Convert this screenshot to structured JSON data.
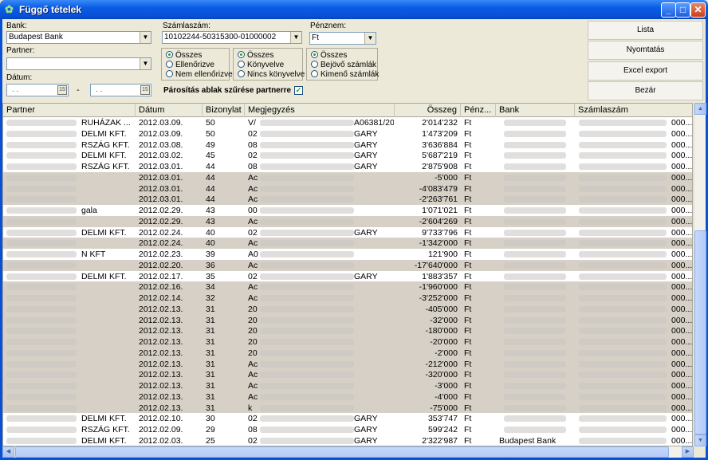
{
  "window": {
    "title": "Függő tételek"
  },
  "filters": {
    "bank_label": "Bank:",
    "bank_value": "Budapest Bank",
    "account_label": "Számlaszám:",
    "account_value": "10102244-50315300-01000002",
    "currency_label": "Pénznem:",
    "currency_value": "Ft",
    "partner_label": "Partner:",
    "partner_value": "",
    "date_label": "Dátum:",
    "date_from": ". .",
    "date_sep": "-",
    "date_to": ". .",
    "group1": [
      "Összes",
      "Ellenőrizve",
      "Nem ellenőrizve"
    ],
    "group2": [
      "Összes",
      "Könyvelve",
      "Nincs könyvelve"
    ],
    "group3": [
      "Összes",
      "Bejövő számlák",
      "Kimenő számlák"
    ],
    "checkbox_label": "Párosítás ablak szűrése partnerre",
    "checkbox_checked": true
  },
  "buttons": {
    "list": "Lista",
    "print": "Nyomtatás",
    "excel": "Excel export",
    "close": "Bezár"
  },
  "columns": [
    "Partner",
    "Dátum",
    "Bizonylat",
    "Megjegyzés",
    "Összeg",
    "Pénz...",
    "Bank",
    "Számlaszám"
  ],
  "rows": [
    {
      "partner": "RUHÁZAK ...",
      "date": "2012.03.09.",
      "doc": "50",
      "note_start": "V/",
      "note_end": "A06381/20",
      "amount": "2'014'232",
      "cur": "Ft",
      "bank": "",
      "acct_end": "000..."
    },
    {
      "partner": "DELMI KFT.",
      "date": "2012.03.09.",
      "doc": "50",
      "note_start": "02",
      "note_end": "GARY",
      "amount": "1'473'209",
      "cur": "Ft",
      "bank": "",
      "acct_end": "000..."
    },
    {
      "partner": "RSZÁG KFT.",
      "date": "2012.03.08.",
      "doc": "49",
      "note_start": "08",
      "note_end": "GARY",
      "amount": "3'636'884",
      "cur": "Ft",
      "bank": "",
      "acct_end": "000..."
    },
    {
      "partner": "DELMI KFT.",
      "date": "2012.03.02.",
      "doc": "45",
      "note_start": "02",
      "note_end": "GARY",
      "amount": "5'687'219",
      "cur": "Ft",
      "bank": "",
      "acct_end": "000..."
    },
    {
      "partner": "RSZÁG KFT.",
      "date": "2012.03.01.",
      "doc": "44",
      "note_start": "08",
      "note_end": "GARY",
      "amount": "2'875'908",
      "cur": "Ft",
      "bank": "",
      "acct_end": "000..."
    },
    {
      "partner": "",
      "date": "2012.03.01.",
      "doc": "44",
      "note_start": "Ac",
      "note_end": "",
      "amount": "-5'000",
      "cur": "Ft",
      "bank": "",
      "acct_end": "000..."
    },
    {
      "partner": "",
      "date": "2012.03.01.",
      "doc": "44",
      "note_start": "Ac",
      "note_end": "",
      "amount": "-4'083'479",
      "cur": "Ft",
      "bank": "",
      "acct_end": "000..."
    },
    {
      "partner": "",
      "date": "2012.03.01.",
      "doc": "44",
      "note_start": "Ac",
      "note_end": "",
      "amount": "-2'263'761",
      "cur": "Ft",
      "bank": "",
      "acct_end": "000..."
    },
    {
      "partner": "gala",
      "date": "2012.02.29.",
      "doc": "43",
      "note_start": "00",
      "note_end": "",
      "amount": "1'071'021",
      "cur": "Ft",
      "bank": "",
      "acct_end": "000..."
    },
    {
      "partner": "",
      "date": "2012.02.29.",
      "doc": "43",
      "note_start": "Ac",
      "note_end": "",
      "amount": "-2'604'269",
      "cur": "Ft",
      "bank": "",
      "acct_end": "000..."
    },
    {
      "partner": "DELMI KFT.",
      "date": "2012.02.24.",
      "doc": "40",
      "note_start": "02",
      "note_end": "GARY",
      "amount": "9'733'796",
      "cur": "Ft",
      "bank": "",
      "acct_end": "000..."
    },
    {
      "partner": "",
      "date": "2012.02.24.",
      "doc": "40",
      "note_start": "Ac",
      "note_end": "",
      "amount": "-1'342'000",
      "cur": "Ft",
      "bank": "",
      "acct_end": "000..."
    },
    {
      "partner": "N KFT",
      "date": "2012.02.23.",
      "doc": "39",
      "note_start": "A0",
      "note_end": "",
      "amount": "121'900",
      "cur": "Ft",
      "bank": "",
      "acct_end": "000..."
    },
    {
      "partner": "",
      "date": "2012.02.20.",
      "doc": "36",
      "note_start": "Ac",
      "note_end": "",
      "amount": "-17'640'000",
      "cur": "Ft",
      "bank": "",
      "acct_end": "000..."
    },
    {
      "partner": "DELMI KFT.",
      "date": "2012.02.17.",
      "doc": "35",
      "note_start": "02",
      "note_end": "GARY",
      "amount": "1'883'357",
      "cur": "Ft",
      "bank": "",
      "acct_end": "000..."
    },
    {
      "partner": "",
      "date": "2012.02.16.",
      "doc": "34",
      "note_start": "Ac",
      "note_end": "",
      "amount": "-1'960'000",
      "cur": "Ft",
      "bank": "",
      "acct_end": "000..."
    },
    {
      "partner": "",
      "date": "2012.02.14.",
      "doc": "32",
      "note_start": "Ac",
      "note_end": "",
      "amount": "-3'252'000",
      "cur": "Ft",
      "bank": "",
      "acct_end": "000..."
    },
    {
      "partner": "",
      "date": "2012.02.13.",
      "doc": "31",
      "note_start": "20",
      "note_end": "",
      "amount": "-405'000",
      "cur": "Ft",
      "bank": "",
      "acct_end": "000..."
    },
    {
      "partner": "",
      "date": "2012.02.13.",
      "doc": "31",
      "note_start": "20",
      "note_end": "",
      "amount": "-32'000",
      "cur": "Ft",
      "bank": "",
      "acct_end": "000..."
    },
    {
      "partner": "",
      "date": "2012.02.13.",
      "doc": "31",
      "note_start": "20",
      "note_end": "",
      "amount": "-180'000",
      "cur": "Ft",
      "bank": "",
      "acct_end": "000..."
    },
    {
      "partner": "",
      "date": "2012.02.13.",
      "doc": "31",
      "note_start": "20",
      "note_end": "",
      "amount": "-20'000",
      "cur": "Ft",
      "bank": "",
      "acct_end": "000..."
    },
    {
      "partner": "",
      "date": "2012.02.13.",
      "doc": "31",
      "note_start": "20",
      "note_end": "",
      "amount": "-2'000",
      "cur": "Ft",
      "bank": "",
      "acct_end": "000..."
    },
    {
      "partner": "",
      "date": "2012.02.13.",
      "doc": "31",
      "note_start": "Ac",
      "note_end": "",
      "amount": "-212'000",
      "cur": "Ft",
      "bank": "",
      "acct_end": "000..."
    },
    {
      "partner": "",
      "date": "2012.02.13.",
      "doc": "31",
      "note_start": "Ac",
      "note_end": "",
      "amount": "-320'000",
      "cur": "Ft",
      "bank": "",
      "acct_end": "000..."
    },
    {
      "partner": "",
      "date": "2012.02.13.",
      "doc": "31",
      "note_start": "Ac",
      "note_end": "",
      "amount": "-3'000",
      "cur": "Ft",
      "bank": "",
      "acct_end": "000..."
    },
    {
      "partner": "",
      "date": "2012.02.13.",
      "doc": "31",
      "note_start": "Ac",
      "note_end": "",
      "amount": "-4'000",
      "cur": "Ft",
      "bank": "",
      "acct_end": "000..."
    },
    {
      "partner": "",
      "date": "2012.02.13.",
      "doc": "31",
      "note_start": "k",
      "note_end": "",
      "amount": "-75'000",
      "cur": "Ft",
      "bank": "",
      "acct_end": "000..."
    },
    {
      "partner": "DELMI KFT.",
      "date": "2012.02.10.",
      "doc": "30",
      "note_start": "02",
      "note_end": "GARY",
      "amount": "353'747",
      "cur": "Ft",
      "bank": "",
      "acct_end": "000..."
    },
    {
      "partner": "RSZÁG KFT.",
      "date": "2012.02.09.",
      "doc": "29",
      "note_start": "08",
      "note_end": "GARY",
      "amount": "599'242",
      "cur": "Ft",
      "bank": "",
      "acct_end": "000..."
    },
    {
      "partner": "DELMI KFT.",
      "date": "2012.02.03.",
      "doc": "25",
      "note_start": "02",
      "note_end": "GARY",
      "amount": "2'322'987",
      "cur": "Ft",
      "bank": "Budapest Bank",
      "acct_end": "000..."
    }
  ],
  "colors": {
    "titlebar": "#0851d6",
    "row_alt": "#d7d0c6"
  }
}
